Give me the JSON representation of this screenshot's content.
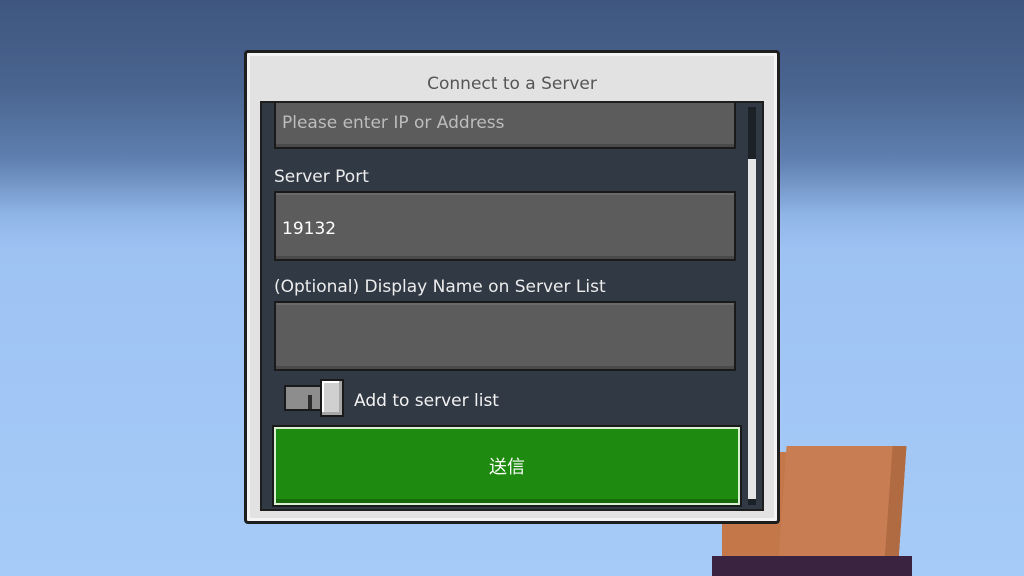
{
  "dialog": {
    "title": "Connect to a Server"
  },
  "form": {
    "address": {
      "value": "",
      "placeholder": "Please enter IP or Address"
    },
    "port": {
      "label": "Server Port",
      "value": "19132"
    },
    "display_name": {
      "label": "(Optional) Display Name on Server List",
      "value": ""
    },
    "add_to_list": {
      "label": "Add to server list",
      "checked": false
    },
    "submit_label": "送信"
  },
  "colors": {
    "accent_green": "#1f8a10",
    "panel_bg": "#313944",
    "field_bg": "#5c5c5c"
  }
}
